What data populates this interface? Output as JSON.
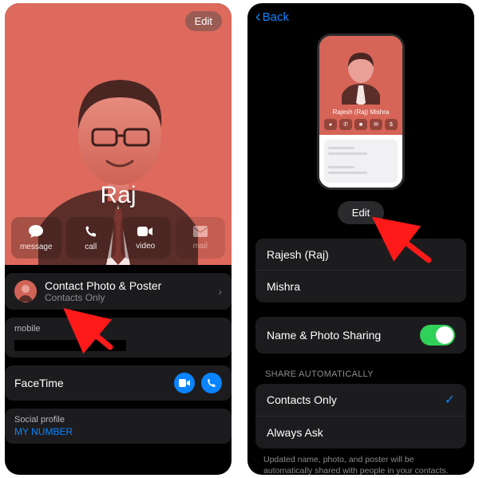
{
  "left": {
    "edit_label": "Edit",
    "contact_name": "Raj",
    "actions": {
      "message": "message",
      "call": "call",
      "video": "video",
      "mail": "mail"
    },
    "poster_row": {
      "title": "Contact Photo & Poster",
      "subtitle": "Contacts Only"
    },
    "mobile_label": "mobile",
    "facetime_label": "FaceTime",
    "social_label": "Social profile",
    "social_value": "MY NUMBER"
  },
  "right": {
    "back_label": "Back",
    "preview_name": "Rajesh (Raj) Mishra",
    "edit_btn": "Edit",
    "first_line": "Rajesh (Raj)",
    "last_line": "Mishra",
    "sharing_label": "Name & Photo Sharing",
    "share_header": "Share Automatically",
    "opt_contacts": "Contacts Only",
    "opt_ask": "Always Ask",
    "footer": "Updated name, photo, and poster will be automatically shared with people in your contacts."
  }
}
